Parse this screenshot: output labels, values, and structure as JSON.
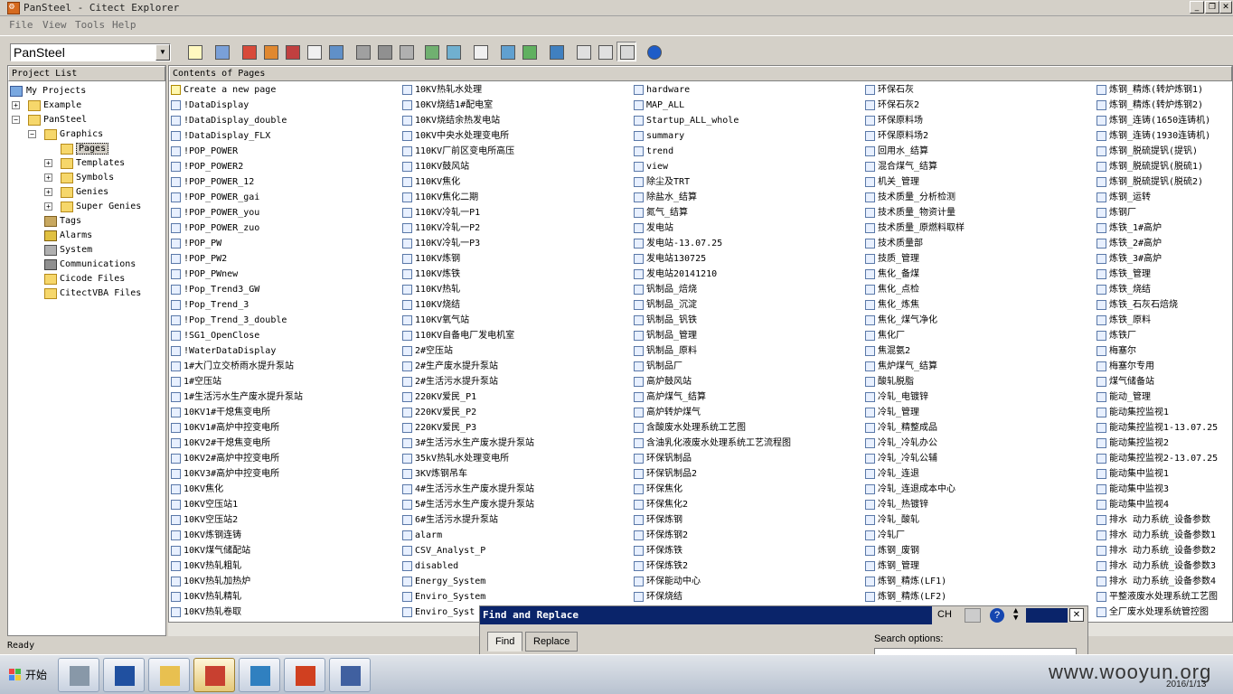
{
  "window": {
    "title": "PanSteel - Citect Explorer"
  },
  "menu": [
    "File",
    "View",
    "Tools",
    "Help"
  ],
  "toolbar": {
    "project": "PanSteel"
  },
  "left_pane": {
    "header": "Project List",
    "tree": [
      "My Projects",
      "Example",
      "PanSteel",
      "Graphics",
      "Pages",
      "Templates",
      "Symbols",
      "Genies",
      "Super Genies",
      "Tags",
      "Alarms",
      "System",
      "Communications",
      "Cicode Files",
      "CitectVBA Files"
    ]
  },
  "right_pane": {
    "header": "Contents of Pages",
    "columns": [
      [
        "Create a new page",
        "!DataDisplay",
        "!DataDisplay_double",
        "!DataDisplay_FLX",
        "!POP_POWER",
        "!POP_POWER2",
        "!POP_POWER_12",
        "!POP_POWER_gai",
        "!POP_POWER_you",
        "!POP_POWER_zuo",
        "!POP_PW",
        "!POP_PW2",
        "!POP_PWnew",
        "!Pop_Trend3_GW",
        "!Pop_Trend_3",
        "!Pop_Trend_3_double",
        "!SG1_OpenClose",
        "!WaterDataDisplay",
        "1#大门立交桥雨水提升泵站",
        "1#空压站",
        "1#生活污水生产废水提升泵站",
        "10KV1#干熄焦变电所",
        "10KV1#高炉中控变电所",
        "10KV2#干熄焦变电所",
        "10KV2#高炉中控变电所",
        "10KV3#高炉中控变电所",
        "10KV焦化",
        "10KV空压站1",
        "10KV空压站2",
        "10KV炼钢连铸",
        "10KV煤气储配站",
        "10KV热轧粗轧",
        "10KV热轧加热炉",
        "10KV热轧精轧",
        "10KV热轧卷取"
      ],
      [
        "10KV热轧水处理",
        "10KV烧结1#配电室",
        "10KV烧结余热发电站",
        "10KV中央水处理变电所",
        "110KV厂前区变电所高压",
        "110KV鼓风站",
        "110KV焦化",
        "110KV焦化二期",
        "110KV冷轧一P1",
        "110KV冷轧一P2",
        "110KV冷轧一P3",
        "110KV炼钢",
        "110KV炼铁",
        "110KV热轧",
        "110KV烧结",
        "110KV氧气站",
        "110KV自备电厂发电机室",
        "2#空压站",
        "2#生产废水提升泵站",
        "2#生活污水提升泵站",
        "220KV爱民_P1",
        "220KV爱民_P2",
        "220KV爱民_P3",
        "3#生活污水生产废水提升泵站",
        "35kV热轧水处理变电所",
        "3KV炼钢吊车",
        "4#生活污水生产废水提升泵站",
        "5#生活污水生产废水提升泵站",
        "6#生活污水提升泵站",
        "alarm",
        "CSV_Analyst_P",
        "disabled",
        "Energy_System",
        "Enviro_System",
        "Enviro_Syst"
      ],
      [
        "hardware",
        "MAP_ALL",
        "Startup_ALL_whole",
        "summary",
        "trend",
        "view",
        "除尘及TRT",
        "除盐水_结算",
        "氮气_结算",
        "发电站",
        "发电站-13.07.25",
        "发电站130725",
        "发电站20141210",
        "钒制品_焙烧",
        "钒制品_沉淀",
        "钒制品_钒铁",
        "钒制品_管理",
        "钒制品_原料",
        "钒制品厂",
        "高炉鼓风站",
        "高炉煤气_结算",
        "高炉转炉煤气",
        "含酸废水处理系统工艺图",
        "含油乳化液废水处理系统工艺流程图",
        "环保钒制品",
        "环保钒制品2",
        "环保焦化",
        "环保焦化2",
        "环保炼钢",
        "环保炼钢2",
        "环保炼铁",
        "环保炼铁2",
        "环保能动中心",
        "环保烧结"
      ],
      [
        "环保石灰",
        "环保石灰2",
        "环保原料场",
        "环保原料场2",
        "回用水_结算",
        "混合煤气_结算",
        "机关_管理",
        "技术质量_分析检测",
        "技术质量_物资计量",
        "技术质量_原燃料取样",
        "技术质量部",
        "技质_管理",
        "焦化_备煤",
        "焦化_点检",
        "焦化_炼焦",
        "焦化_煤气净化",
        "焦化厂",
        "焦混氨2",
        "焦炉煤气_结算",
        "酸轧脱脂",
        "冷轧_电镀锌",
        "冷轧_管理",
        "冷轧_精整成品",
        "冷轧_冷轧办公",
        "冷轧_冷轧公辅",
        "冷轧_连退",
        "冷轧_连退成本中心",
        "冷轧_热镀锌",
        "冷轧_酸轧",
        "冷轧厂",
        "炼钢_废钢",
        "炼钢_管理",
        "炼钢_精炼(LF1)",
        "炼钢_精炼(LF2)"
      ],
      [
        "炼钢_精炼(转炉炼钢1)",
        "炼钢_精炼(转炉炼钢2)",
        "炼钢_连铸(1650连铸机)",
        "炼钢_连铸(1930连铸机)",
        "炼钢_脱硫提钒(提钒)",
        "炼钢_脱硫提钒(脱硫1)",
        "炼钢_脱硫提钒(脱硫2)",
        "炼钢_运转",
        "炼钢厂",
        "炼铁_1#高炉",
        "炼铁_2#高炉",
        "炼铁_3#高炉",
        "炼铁_管理",
        "炼铁_烧结",
        "炼铁_石灰石焙烧",
        "炼铁_原料",
        "炼铁厂",
        "梅塞尔",
        "梅塞尔专用",
        "煤气储备站",
        "能动_管理",
        "能动集控监视1",
        "能动集控监视1-13.07.25",
        "能动集控监视2",
        "能动集控监视2-13.07.25",
        "能动集中监视1",
        "能动集中监视3",
        "能动集中监视4",
        "排水 动力系统_设备参数",
        "排水 动力系统_设备参数1",
        "排水 动力系统_设备参数2",
        "排水 动力系统_设备参数3",
        "排水 动力系统_设备参数4",
        "平整液废水处理系统工艺图",
        "全厂废水处理系统管控图"
      ]
    ]
  },
  "status": "Ready",
  "find_replace": {
    "title": "Find and Replace",
    "lang": "CH",
    "help": "?",
    "close": "✕",
    "tabs": [
      "Find",
      "Replace"
    ],
    "search_label": "Search options:"
  },
  "taskbar": {
    "start": "开始",
    "watermark": "www.wooyun.org",
    "date": "2016/1/13"
  }
}
